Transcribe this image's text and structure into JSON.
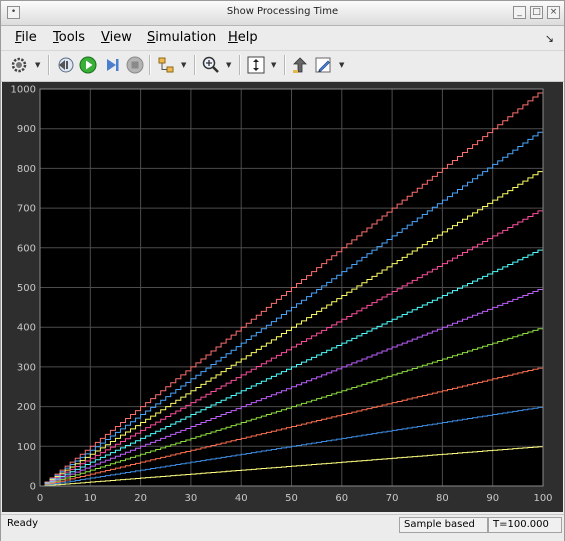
{
  "window": {
    "title": "Show Processing Time"
  },
  "menu": [
    {
      "label": "File",
      "mnemonic": "F",
      "rest": "ile"
    },
    {
      "label": "Tools",
      "mnemonic": "T",
      "rest": "ools"
    },
    {
      "label": "View",
      "mnemonic": "V",
      "rest": "iew"
    },
    {
      "label": "Simulation",
      "mnemonic": "S",
      "rest": "imulation"
    },
    {
      "label": "Help",
      "mnemonic": "H",
      "rest": "elp"
    }
  ],
  "toolbar": {
    "icons": [
      "gear-icon",
      "step-back-icon",
      "run-icon",
      "step-forward-icon",
      "stop-icon",
      "hierarchy-icon",
      "zoom-in-icon",
      "autoscale-icon",
      "highlight-icon",
      "edit-icon"
    ]
  },
  "status": {
    "ready": "Ready",
    "mode": "Sample based",
    "time": "T=100.000"
  },
  "chart_data": {
    "type": "line",
    "step": true,
    "xlim": [
      0,
      100
    ],
    "ylim": [
      0,
      1000
    ],
    "xticks": [
      0,
      10,
      20,
      30,
      40,
      50,
      60,
      70,
      80,
      90,
      100
    ],
    "yticks": [
      0,
      100,
      200,
      300,
      400,
      500,
      600,
      700,
      800,
      900,
      1000
    ],
    "grid": true,
    "background": "#000000",
    "series": [
      {
        "slope": 10,
        "x": [
          0,
          100
        ],
        "y": [
          0,
          1000
        ],
        "color": "#ff7070"
      },
      {
        "slope": 9,
        "x": [
          0,
          100
        ],
        "y": [
          0,
          900
        ],
        "color": "#4aa8ff"
      },
      {
        "slope": 8,
        "x": [
          0,
          100
        ],
        "y": [
          0,
          800
        ],
        "color": "#ffff66"
      },
      {
        "slope": 7,
        "x": [
          0,
          100
        ],
        "y": [
          0,
          700
        ],
        "color": "#ff4fa0"
      },
      {
        "slope": 6,
        "x": [
          0,
          100
        ],
        "y": [
          0,
          600
        ],
        "color": "#4fffff"
      },
      {
        "slope": 5,
        "x": [
          0,
          100
        ],
        "y": [
          0,
          500
        ],
        "color": "#c060ff"
      },
      {
        "slope": 4,
        "x": [
          0,
          100
        ],
        "y": [
          0,
          400
        ],
        "color": "#90e040"
      },
      {
        "slope": 3,
        "x": [
          0,
          100
        ],
        "y": [
          0,
          300
        ],
        "color": "#ff7050"
      },
      {
        "slope": 2,
        "x": [
          0,
          100
        ],
        "y": [
          0,
          200
        ],
        "color": "#3f8fe8"
      },
      {
        "slope": 1,
        "x": [
          0,
          100
        ],
        "y": [
          0,
          100
        ],
        "color": "#ffff80"
      }
    ]
  }
}
